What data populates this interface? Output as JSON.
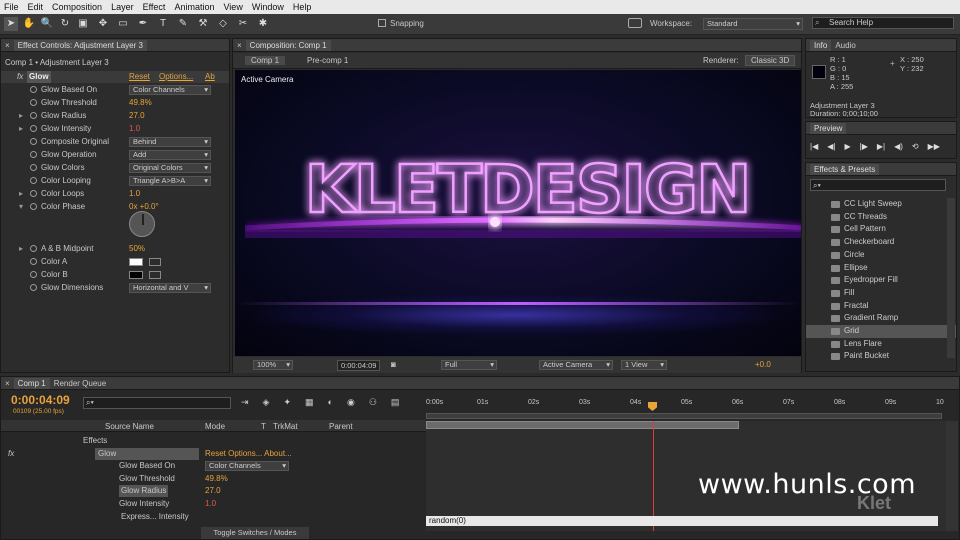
{
  "menu": [
    "File",
    "Edit",
    "Composition",
    "Layer",
    "Effect",
    "Animation",
    "View",
    "Window",
    "Help"
  ],
  "toolbar": {
    "snapping": "Snapping",
    "workspace_label": "Workspace:",
    "workspace_value": "Standard",
    "search_help": "Search Help"
  },
  "effect_controls": {
    "tab": "Effect Controls: Adjustment Layer 3",
    "breadcrumb": "Comp 1 • Adjustment Layer 3",
    "effect_name": "Glow",
    "reset": "Reset",
    "options": "Options...",
    "about": "Ab",
    "props": [
      {
        "name": "Glow Based On",
        "value": "Color Channels",
        "kind": "dropdown"
      },
      {
        "name": "Glow Threshold",
        "value": "49.8%",
        "kind": "orange"
      },
      {
        "name": "Glow Radius",
        "value": "27.0",
        "kind": "orange"
      },
      {
        "name": "Glow Intensity",
        "value": "1.0",
        "kind": "red"
      },
      {
        "name": "Composite Original",
        "value": "Behind",
        "kind": "dropdown"
      },
      {
        "name": "Glow Operation",
        "value": "Add",
        "kind": "dropdown"
      },
      {
        "name": "Glow Colors",
        "value": "Original Colors",
        "kind": "dropdown"
      },
      {
        "name": "Color Looping",
        "value": "Triangle A>B>A",
        "kind": "dropdown"
      },
      {
        "name": "Color Loops",
        "value": "1.0",
        "kind": "orange"
      },
      {
        "name": "Color Phase",
        "value": "0x +0.0°",
        "kind": "orange"
      },
      {
        "name": "A & B Midpoint",
        "value": "50%",
        "kind": "orange"
      },
      {
        "name": "Color A",
        "value": "",
        "kind": "swatch-white"
      },
      {
        "name": "Color B",
        "value": "",
        "kind": "swatch-black"
      },
      {
        "name": "Glow Dimensions",
        "value": "Horizontal and V",
        "kind": "dropdown"
      }
    ]
  },
  "composition": {
    "tab": "Composition: Comp 1",
    "crumb1": "Comp 1",
    "crumb2": "Pre-comp 1",
    "renderer_label": "Renderer:",
    "renderer_value": "Classic 3D",
    "camera_label": "Active Camera",
    "title_text": "KLETDESIGN",
    "footer": {
      "zoom": "100%",
      "time": "0:00:04:09",
      "resolution": "Full",
      "camera": "Active Camera",
      "view": "1 View",
      "exposure": "+0.0"
    }
  },
  "info": {
    "tab_info": "Info",
    "tab_audio": "Audio",
    "r": "R : 1",
    "g": "G : 0",
    "b": "B : 15",
    "a": "A : 255",
    "x": "X : 250",
    "y": "Y : 232",
    "layer": "Adjustment Layer 3",
    "duration": "Duration: 0;00;10;00"
  },
  "preview": {
    "tab": "Preview"
  },
  "effects_presets": {
    "tab": "Effects & Presets",
    "items": [
      "CC Light Sweep",
      "CC Threads",
      "Cell Pattern",
      "Checkerboard",
      "Circle",
      "Ellipse",
      "Eyedropper Fill",
      "Fill",
      "Fractal",
      "Gradient Ramp",
      "Grid",
      "Lens Flare",
      "Paint Bucket"
    ],
    "selected": "Grid"
  },
  "timeline": {
    "tab_comp": "Comp 1",
    "tab_render": "Render Queue",
    "timecode": "0:00:04:09",
    "frames": "00109 (25.00 fps)",
    "col_source": "Source Name",
    "col_mode": "Mode",
    "col_t": "T",
    "col_trkmat": "TrkMat",
    "col_parent": "Parent",
    "ruler": [
      "0:00s",
      "01s",
      "02s",
      "03s",
      "04s",
      "05s",
      "06s",
      "07s",
      "08s",
      "09s",
      "10"
    ],
    "rows": [
      {
        "label": "Effects",
        "value": "",
        "indent": 1
      },
      {
        "label": "Glow",
        "value": "Reset   Options...     About...",
        "indent": 2
      },
      {
        "label": "Glow Based On",
        "value": "Color Channels",
        "indent": 3
      },
      {
        "label": "Glow Threshold",
        "value": "49.8%",
        "indent": 3
      },
      {
        "label": "Glow Radius",
        "value": "27.0",
        "indent": 3
      },
      {
        "label": "Glow Intensity",
        "value": "1.0",
        "indent": 3
      },
      {
        "label": "Express... Intensity",
        "value": "",
        "indent": 4
      }
    ],
    "expression": "random(0)",
    "toggle": "Toggle Switches / Modes",
    "watermark": "www.hunls.com",
    "brand": "Klet"
  }
}
